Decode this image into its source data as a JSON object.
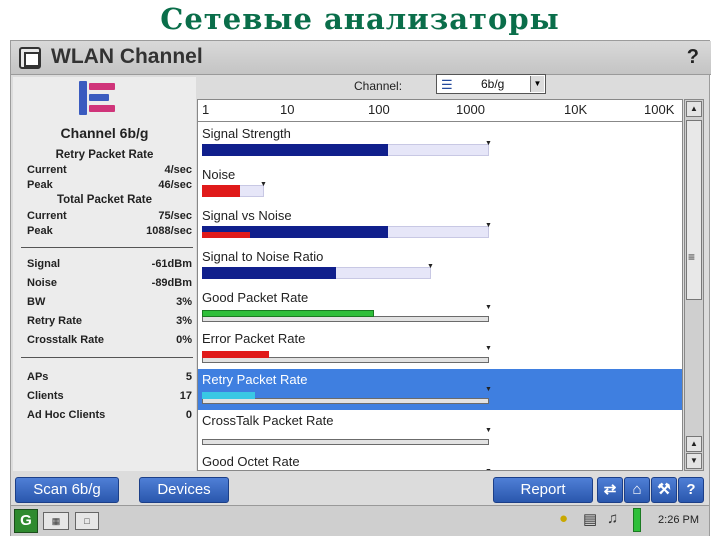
{
  "slide": {
    "title": "Сетевые анализаторы"
  },
  "window": {
    "title": "WLAN Channel",
    "help_glyph": "?"
  },
  "left_panel": {
    "channel_title": "Channel 6b/g",
    "retry_header": "Retry Packet Rate",
    "retry_current_label": "Current",
    "retry_current_value": "4/sec",
    "retry_peak_label": "Peak",
    "retry_peak_value": "46/sec",
    "total_header": "Total Packet Rate",
    "total_current_label": "Current",
    "total_current_value": "75/sec",
    "total_peak_label": "Peak",
    "total_peak_value": "1088/sec",
    "signal_label": "Signal",
    "signal_value": "-61dBm",
    "noise_label": "Noise",
    "noise_value": "-89dBm",
    "bw_label": "BW",
    "bw_value": "3%",
    "retry_rate_label": "Retry Rate",
    "retry_rate_value": "3%",
    "crosstalk_label": "Crosstalk Rate",
    "crosstalk_value": "0%",
    "aps_label": "APs",
    "aps_value": "5",
    "clients_label": "Clients",
    "clients_value": "17",
    "adhoc_label": "Ad Hoc Clients",
    "adhoc_value": "0"
  },
  "channel_selector": {
    "label": "Channel:",
    "value": "6b/g"
  },
  "scale": [
    "1",
    "10",
    "100",
    "1000",
    "10K",
    "100K"
  ],
  "metrics": [
    {
      "label": "Signal Strength",
      "level": 0.39,
      "max": 0.6,
      "style": "blue",
      "selected": false
    },
    {
      "label": "Noise",
      "level": 0.08,
      "max": 0.13,
      "style": "red",
      "selected": false
    },
    {
      "label": "Signal vs Noise",
      "level": 0.39,
      "secondary": 0.1,
      "max": 0.6,
      "style": "blue",
      "selected": false
    },
    {
      "label": "Signal to Noise Ratio",
      "level": 0.28,
      "max": 0.48,
      "style": "blue",
      "selected": false
    },
    {
      "label": "Good Packet Rate",
      "level": 0.36,
      "max": 0.6,
      "style": "green",
      "selected": false
    },
    {
      "label": "Error Packet Rate",
      "level": 0.14,
      "max": 0.6,
      "style": "red",
      "selected": false
    },
    {
      "label": "Retry Packet Rate",
      "level": 0.11,
      "max": 0.6,
      "style": "cyan",
      "selected": true
    },
    {
      "label": "CrossTalk Packet Rate",
      "level": 0.0,
      "max": 0.6,
      "style": "grey",
      "selected": false
    },
    {
      "label": "Good Octet Rate",
      "level": 0.0,
      "max": 0.6,
      "style": "grey",
      "selected": false
    }
  ],
  "buttons": {
    "scan": "Scan 6b/g",
    "devices": "Devices",
    "report": "Report"
  },
  "taskbar": {
    "logo_text": "G",
    "clock": "2:26 PM"
  },
  "colors": {
    "accent": "#2a57ad",
    "selection": "#3f7fe0",
    "title_green": "#0a6e4a"
  }
}
